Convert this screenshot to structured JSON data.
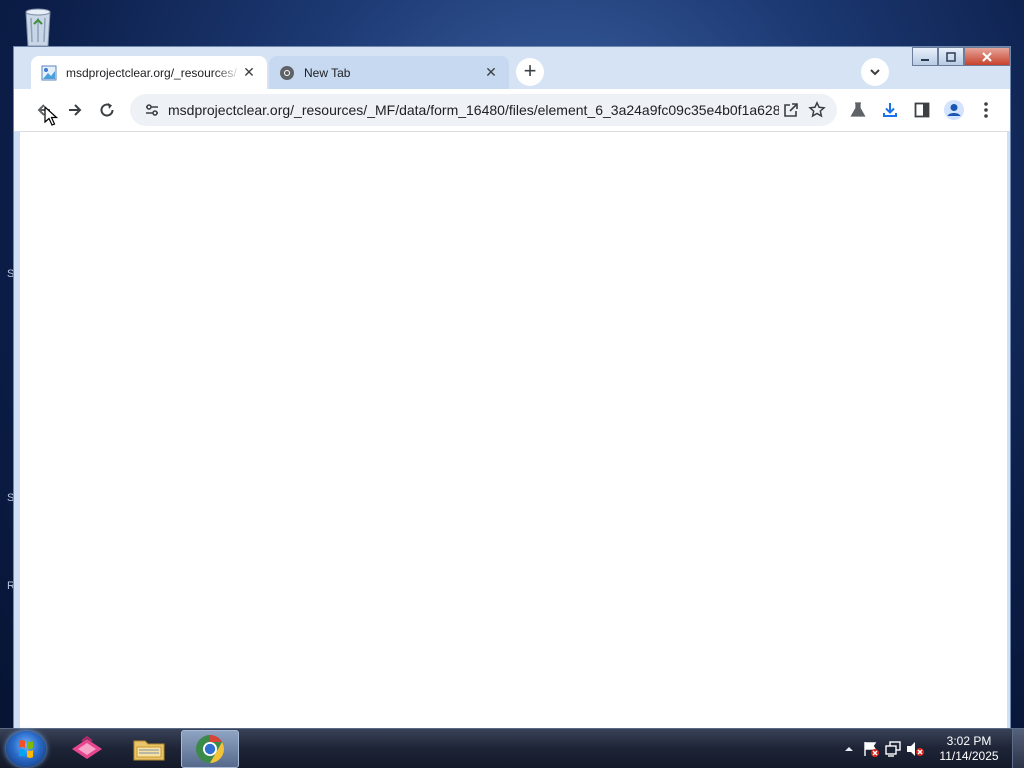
{
  "desktop": {
    "recycle_bin_icon": "recycle-bin-icon",
    "edge_letters": [
      "S",
      "S",
      "R"
    ]
  },
  "browser": {
    "tabs": [
      {
        "title": "msdprojectclear.org/_resources/",
        "favicon": "page-image-icon",
        "active": true
      },
      {
        "title": "New Tab",
        "favicon": "chrome-icon",
        "active": false
      }
    ],
    "new_tab_label": "+",
    "address_bar": {
      "url": "msdprojectclear.org/_resources/_MF/data/form_16480/files/element_6_3a24a9fc09c35e4b0f1a6286..."
    },
    "toolbar_icons": [
      "back-arrow-icon",
      "forward-arrow-icon",
      "reload-icon",
      "tune-icon",
      "share-icon",
      "bookmark-star-icon",
      "labs-flask-icon",
      "download-icon",
      "side-panel-icon",
      "profile-icon",
      "more-menu-icon"
    ]
  },
  "taskbar": {
    "apps": [
      "start-orb",
      "pink-app",
      "file-explorer",
      "chrome"
    ],
    "clock": {
      "time": "3:02 PM",
      "date": "11/14/2025"
    },
    "tray_icons": [
      "show-hidden-icons-arrow",
      "action-center-flag-icon",
      "network-icon",
      "volume-muted-icon"
    ]
  },
  "colors": {
    "tabstrip": "#d6e3f4",
    "omnibox": "#eef1f6",
    "taskbar": "#1d2436",
    "download_accent": "#1a73e8"
  }
}
